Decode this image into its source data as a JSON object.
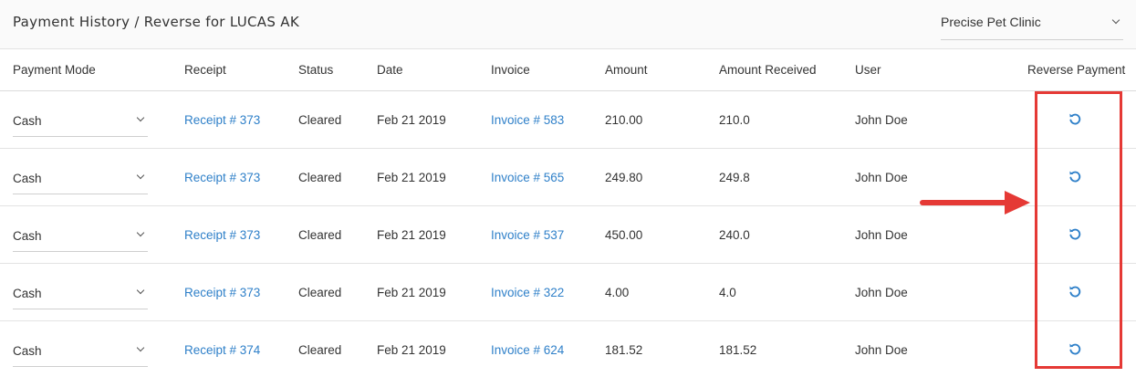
{
  "header": {
    "title": "Payment History / Reverse for LUCAS AK",
    "clinic_selected": "Precise Pet Clinic"
  },
  "columns": {
    "payment_mode": "Payment Mode",
    "receipt": "Receipt",
    "status": "Status",
    "date": "Date",
    "invoice": "Invoice",
    "amount": "Amount",
    "amount_received": "Amount Received",
    "user": "User",
    "reverse_payment": "Reverse Payment"
  },
  "rows": [
    {
      "mode": "Cash",
      "receipt": "Receipt # 373",
      "status": "Cleared",
      "date": "Feb 21 2019",
      "invoice": "Invoice # 583",
      "amount": "210.00",
      "received": "210.0",
      "user": "John Doe"
    },
    {
      "mode": "Cash",
      "receipt": "Receipt # 373",
      "status": "Cleared",
      "date": "Feb 21 2019",
      "invoice": "Invoice # 565",
      "amount": "249.80",
      "received": "249.8",
      "user": "John Doe"
    },
    {
      "mode": "Cash",
      "receipt": "Receipt # 373",
      "status": "Cleared",
      "date": "Feb 21 2019",
      "invoice": "Invoice # 537",
      "amount": "450.00",
      "received": "240.0",
      "user": "John Doe"
    },
    {
      "mode": "Cash",
      "receipt": "Receipt # 373",
      "status": "Cleared",
      "date": "Feb 21 2019",
      "invoice": "Invoice # 322",
      "amount": "4.00",
      "received": "4.0",
      "user": "John Doe"
    },
    {
      "mode": "Cash",
      "receipt": "Receipt # 374",
      "status": "Cleared",
      "date": "Feb 21 2019",
      "invoice": "Invoice # 624",
      "amount": "181.52",
      "received": "181.52",
      "user": "John Doe"
    }
  ],
  "icons": {
    "reverse": "undo-icon",
    "dropdown": "chevron-down-icon"
  },
  "colors": {
    "link": "#2f80c9",
    "annotation": "#e53935"
  }
}
